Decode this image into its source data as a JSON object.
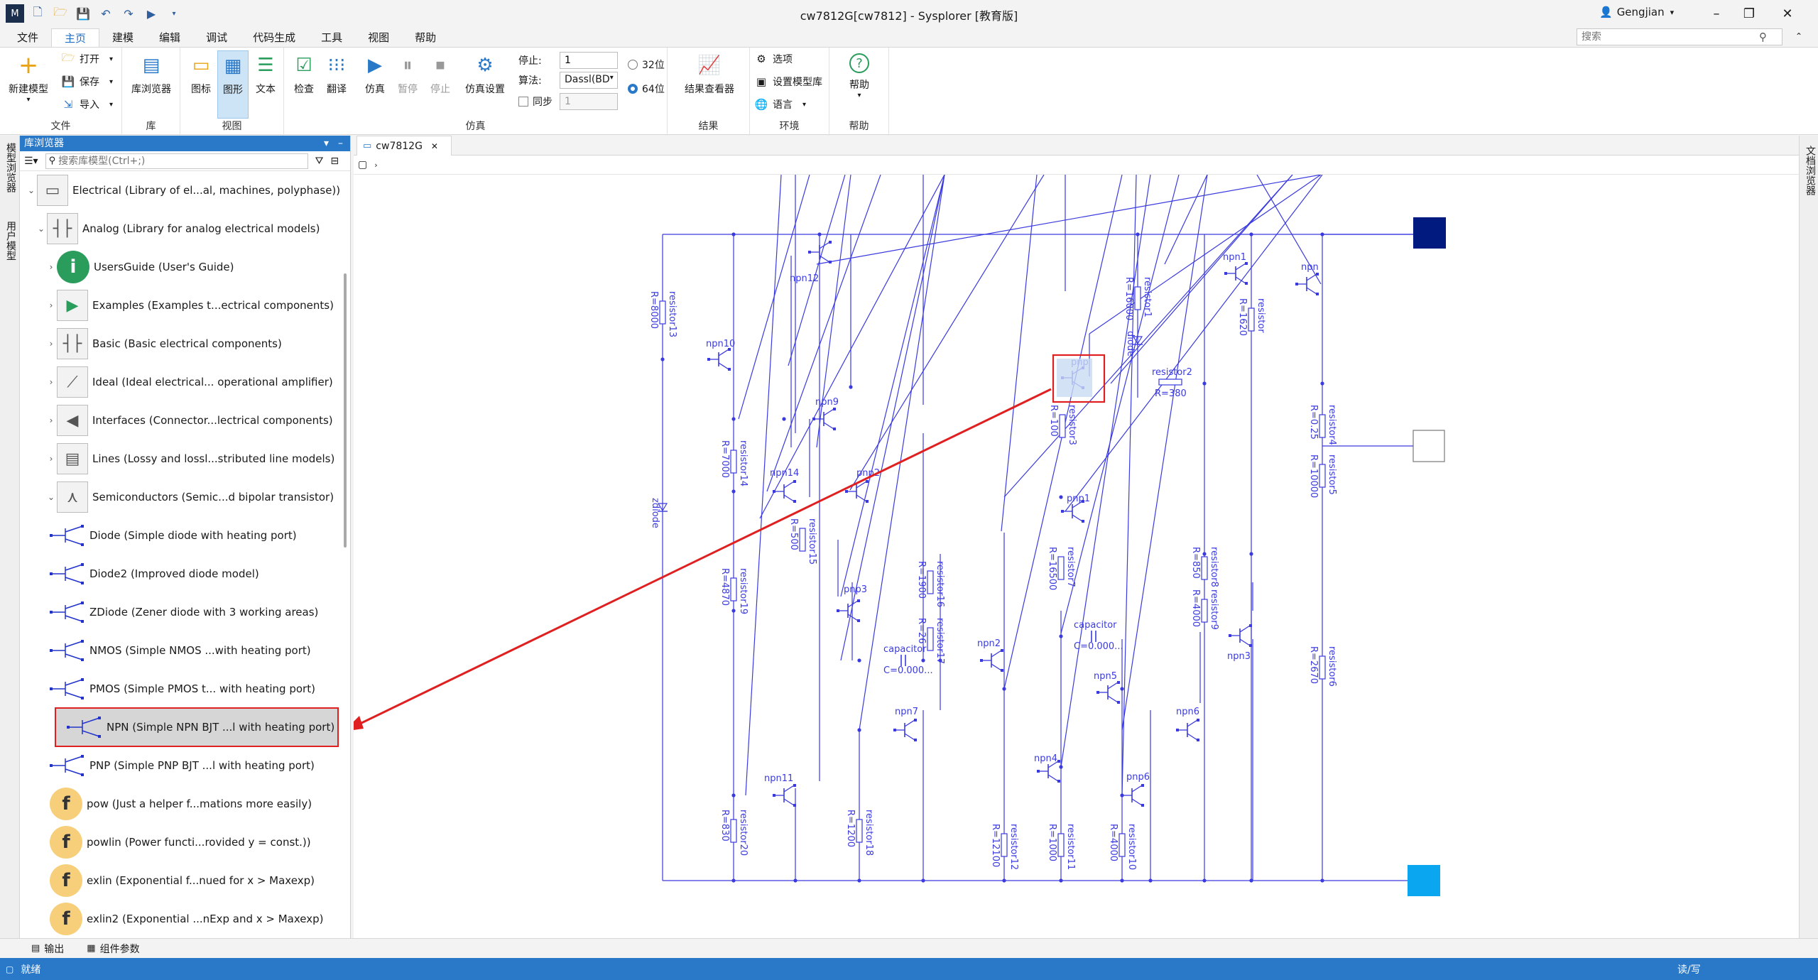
{
  "window": {
    "title": "cw7812G[cw7812] - Sysplorer [教育版]",
    "user": "Gengjian"
  },
  "menu": [
    "文件",
    "主页",
    "建模",
    "编辑",
    "调试",
    "代码生成",
    "工具",
    "视图",
    "帮助"
  ],
  "search": {
    "placeholder": "搜索"
  },
  "ribbon": {
    "file_group": "文件",
    "new_model": "新建模型",
    "open": "打开",
    "save": "保存",
    "import": "导入",
    "lib_group": "库",
    "lib_browser": "库浏览器",
    "view_group": "视图",
    "icon_view": "图标",
    "diagram_view": "图形",
    "text_view": "文本",
    "check": "检查",
    "translate": "翻译",
    "sim_group": "仿真",
    "simulate": "仿真",
    "pause": "暂停",
    "stop": "停止",
    "sim_settings": "仿真设置",
    "stop_label": "停止:",
    "stop_value": "1",
    "algo_label": "算法:",
    "algo_value": "Dassl(BD",
    "sync_label": "同步",
    "sync_value": "1",
    "bit32": "32位",
    "bit64": "64位",
    "result_group": "结果",
    "result_viewer": "结果查看器",
    "env_group": "环境",
    "options": "选项",
    "set_model_lib": "设置模型库",
    "language": "语言",
    "help_group": "帮助",
    "help": "帮助"
  },
  "left_strip": {
    "model_browser": "模型浏览器",
    "user_model": "用户模型"
  },
  "library_browser": {
    "title": "库浏览器",
    "search_placeholder": "搜索库模型(Ctrl+;)",
    "items": [
      {
        "label": "Electrical (Library of el...al, machines, polyphase))",
        "level": 0,
        "state": "open"
      },
      {
        "label": "Analog (Library for analog electrical models)",
        "level": 1,
        "state": "open"
      },
      {
        "label": "UsersGuide (User's Guide)",
        "level": 2,
        "state": "closed"
      },
      {
        "label": "Examples (Examples t...ectrical components)",
        "level": 2,
        "state": "closed"
      },
      {
        "label": "Basic (Basic electrical components)",
        "level": 2,
        "state": "closed"
      },
      {
        "label": "Ideal (Ideal electrical... operational amplifier)",
        "level": 2,
        "state": "closed"
      },
      {
        "label": "Interfaces (Connector...lectrical components)",
        "level": 2,
        "state": "closed"
      },
      {
        "label": "Lines (Lossy and lossl...stributed line models)",
        "level": 2,
        "state": "closed"
      },
      {
        "label": "Semiconductors (Semic...d bipolar transistor)",
        "level": 2,
        "state": "open"
      },
      {
        "label": "Diode (Simple diode with heating port)",
        "level": 3
      },
      {
        "label": "Diode2 (Improved diode model)",
        "level": 3
      },
      {
        "label": "ZDiode (Zener diode with 3 working areas)",
        "level": 3
      },
      {
        "label": "NMOS (Simple NMOS ...with heating port)",
        "level": 3
      },
      {
        "label": "PMOS (Simple PMOS t... with heating port)",
        "level": 3
      },
      {
        "label": "NPN (Simple NPN BJT ...l with heating port)",
        "level": 3,
        "selected": true
      },
      {
        "label": "PNP (Simple PNP BJT ...l with heating port)",
        "level": 3
      },
      {
        "label": "pow (Just a helper f...mations more easily)",
        "level": 3
      },
      {
        "label": "powlin (Power functi...rovided y = const.))",
        "level": 3
      },
      {
        "label": "exlin (Exponential f...nued for x > Maxexp)",
        "level": 3
      },
      {
        "label": "exlin2 (Exponential ...nExp and x > Maxexp)",
        "level": 3
      }
    ]
  },
  "tab": {
    "label": "cw7812G"
  },
  "right_strip": {
    "doc_browser": "文档浏览器"
  },
  "bottom_tabs": {
    "output": "输出",
    "params": "组件参数"
  },
  "status": {
    "left": "就绪",
    "right": "读/写"
  },
  "diagram": {
    "transistors": [
      "npn12",
      "npn1",
      "npn",
      "npn10",
      "pnp",
      "npn9",
      "npn14",
      "pnp2",
      "pnp1",
      "pnp3",
      "npn2",
      "npn3",
      "npn5",
      "npn7",
      "npn6",
      "npn4",
      "pnp6",
      "npn11"
    ],
    "resistors": [
      {
        "name": "resistor13",
        "value": "R=8000"
      },
      {
        "name": "resistor1",
        "value": "R=16000"
      },
      {
        "name": "resistor",
        "value": "R=1620"
      },
      {
        "name": "resistor2",
        "value": "R=380"
      },
      {
        "name": "resistor3",
        "value": "R=100"
      },
      {
        "name": "resistor4",
        "value": "R=0.25"
      },
      {
        "name": "resistor5",
        "value": "R=10000"
      },
      {
        "name": "resistor14",
        "value": "R=7000"
      },
      {
        "name": "resistor15",
        "value": "R=500"
      },
      {
        "name": "resistor16",
        "value": "R=1900"
      },
      {
        "name": "resistor17",
        "value": "R=26"
      },
      {
        "name": "resistor19",
        "value": "R=4870"
      },
      {
        "name": "resistor7",
        "value": "R=16500"
      },
      {
        "name": "resistor8",
        "value": "R=850"
      },
      {
        "name": "resistor9",
        "value": "R=4000"
      },
      {
        "name": "resistor6",
        "value": "R=2670"
      },
      {
        "name": "resistor20",
        "value": "R=830"
      },
      {
        "name": "resistor18",
        "value": "R=1200"
      },
      {
        "name": "resistor12",
        "value": "R=12100"
      },
      {
        "name": "resistor11",
        "value": "R=1000"
      },
      {
        "name": "resistor10",
        "value": "R=4000"
      }
    ],
    "diodes": [
      "diode",
      "zdiode"
    ],
    "capacitors": [
      {
        "name": "capacitor",
        "value": "C=0.000..."
      },
      {
        "name": "capacitor",
        "value": "C=0.000..."
      }
    ]
  },
  "colors": {
    "accent": "#2a78c8",
    "wire": "#3a3adf",
    "annotation": "#e02020",
    "port_dark": "#001a80",
    "port_light": "#0aa6f0"
  }
}
